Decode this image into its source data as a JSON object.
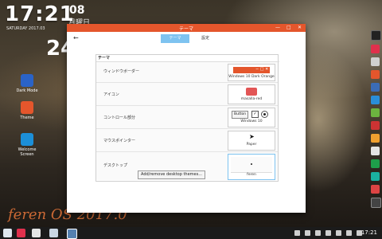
{
  "desktop": {
    "clock": "17:21",
    "clock_sub": "SATURDAY 2017.03",
    "date_big": "08",
    "date_dow": "月曜日",
    "date_24": "24",
    "icons": [
      {
        "label": "Dark Mode",
        "color": "#2a63c7"
      },
      {
        "label": "Theme",
        "color": "#e4562c"
      },
      {
        "label": "Welcome Screen",
        "color": "#1c8fd8"
      }
    ],
    "watermark": "feren OS 2017.0"
  },
  "window": {
    "title": "テーマ",
    "controls": {
      "minimize": "—",
      "maximize": "□",
      "close": "✕"
    },
    "back_label": "←",
    "tabs": [
      {
        "label": "テーマ",
        "active": true
      },
      {
        "label": "設定",
        "active": false
      }
    ],
    "section": "テーマ",
    "rows": [
      {
        "label": "ウィンドウボーダー",
        "value": "Windows 10 Dark Orange"
      },
      {
        "label": "アイコン",
        "value": "masalla-red"
      },
      {
        "label": "コントロール部分",
        "value": "Windows 10",
        "button_label": "Button"
      },
      {
        "label": "マウスポインター",
        "value": "Paper"
      },
      {
        "label": "デスクトップ",
        "value": "feren"
      }
    ],
    "add_button": "Add/remove desktop themes..."
  },
  "taskbar": {
    "time": "17:21"
  },
  "colors": {
    "accent": "#e4562c",
    "tab_active": "#7ec3f0"
  }
}
